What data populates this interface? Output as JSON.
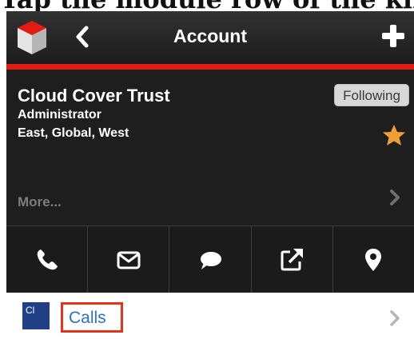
{
  "caption": "Tap the module row of the kind",
  "nav": {
    "title": "Account",
    "logo_icon": "sugar-cube-icon",
    "back_icon": "chevron-left-icon",
    "add_icon": "plus-icon",
    "accent_color": "#e41b13"
  },
  "account": {
    "name": "Cloud Cover Trust",
    "role": "Administrator",
    "regions": "East, Global, West",
    "following_label": "Following",
    "favorite_icon": "star-icon",
    "favorite_color": "#f0a033",
    "more_label": "More..."
  },
  "actions": [
    {
      "name": "call",
      "icon": "phone-icon"
    },
    {
      "name": "email",
      "icon": "envelope-icon"
    },
    {
      "name": "message",
      "icon": "chat-bubble-icon"
    },
    {
      "name": "open",
      "icon": "external-link-icon"
    },
    {
      "name": "map",
      "icon": "map-pin-icon"
    }
  ],
  "module_row": {
    "badge": "Cl",
    "label": "Calls",
    "highlight_color": "#e7321c"
  }
}
